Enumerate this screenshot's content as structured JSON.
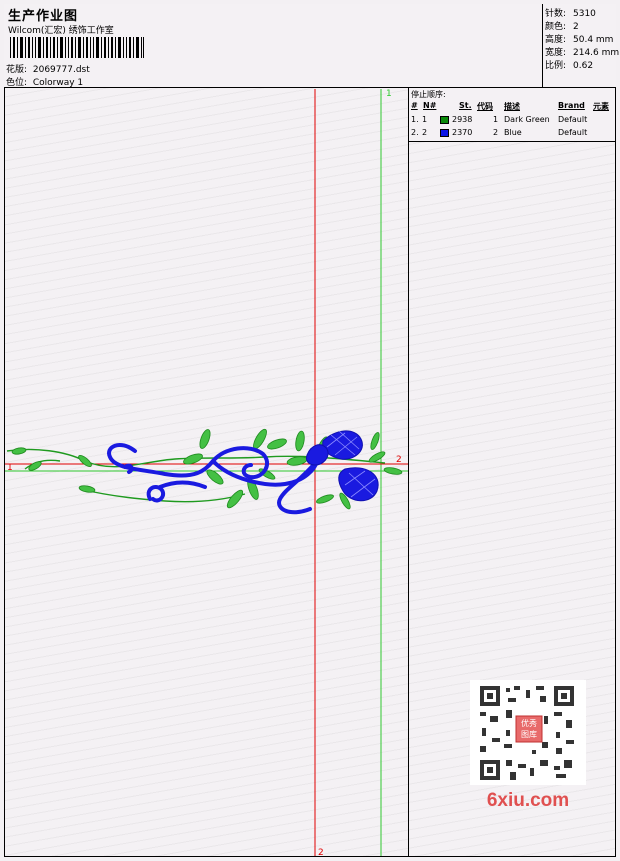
{
  "header": {
    "title": "生产作业图",
    "subtitle": "Wilcom(汇宏) 绣饰工作室",
    "design_label": "花版:",
    "design_value": "2069777.dst",
    "color_label": "色位:",
    "color_value": "Colorway 1"
  },
  "stats": {
    "stitches_label": "针数:",
    "stitches_value": "5310",
    "colors_label": "颜色:",
    "colors_value": "2",
    "height_label": "高度:",
    "height_value": "50.4 mm",
    "width_label": "宽度:",
    "width_value": "214.6 mm",
    "ratio_label": "比例:",
    "ratio_value": "0.62"
  },
  "stop_sequence": {
    "title": "停止顺序:",
    "columns": [
      "#",
      "N#",
      "St.",
      "代码",
      "描述",
      "Brand",
      "元素"
    ],
    "rows": [
      {
        "idx": "1.",
        "n": "1",
        "st": "2938",
        "code": "1",
        "desc": "Dark Green",
        "brand": "Default",
        "color": "#0a8a0a"
      },
      {
        "idx": "2.",
        "n": "2",
        "st": "2370",
        "code": "2",
        "desc": "Blue",
        "brand": "Default",
        "color": "#0a14e6"
      }
    ]
  },
  "guides": {
    "green_vertical_label": "1",
    "red_vertical_label": "2",
    "red_horizontal_label": "2",
    "green_horizontal_label": "1"
  },
  "watermark": {
    "text": "6xiu.com",
    "stamp": "优秀图库"
  },
  "colors": {
    "green_thread": "#1f9a1f",
    "blue_thread": "#1a1ae0",
    "guide_red": "#e00000",
    "guide_green": "#2ec82e"
  }
}
